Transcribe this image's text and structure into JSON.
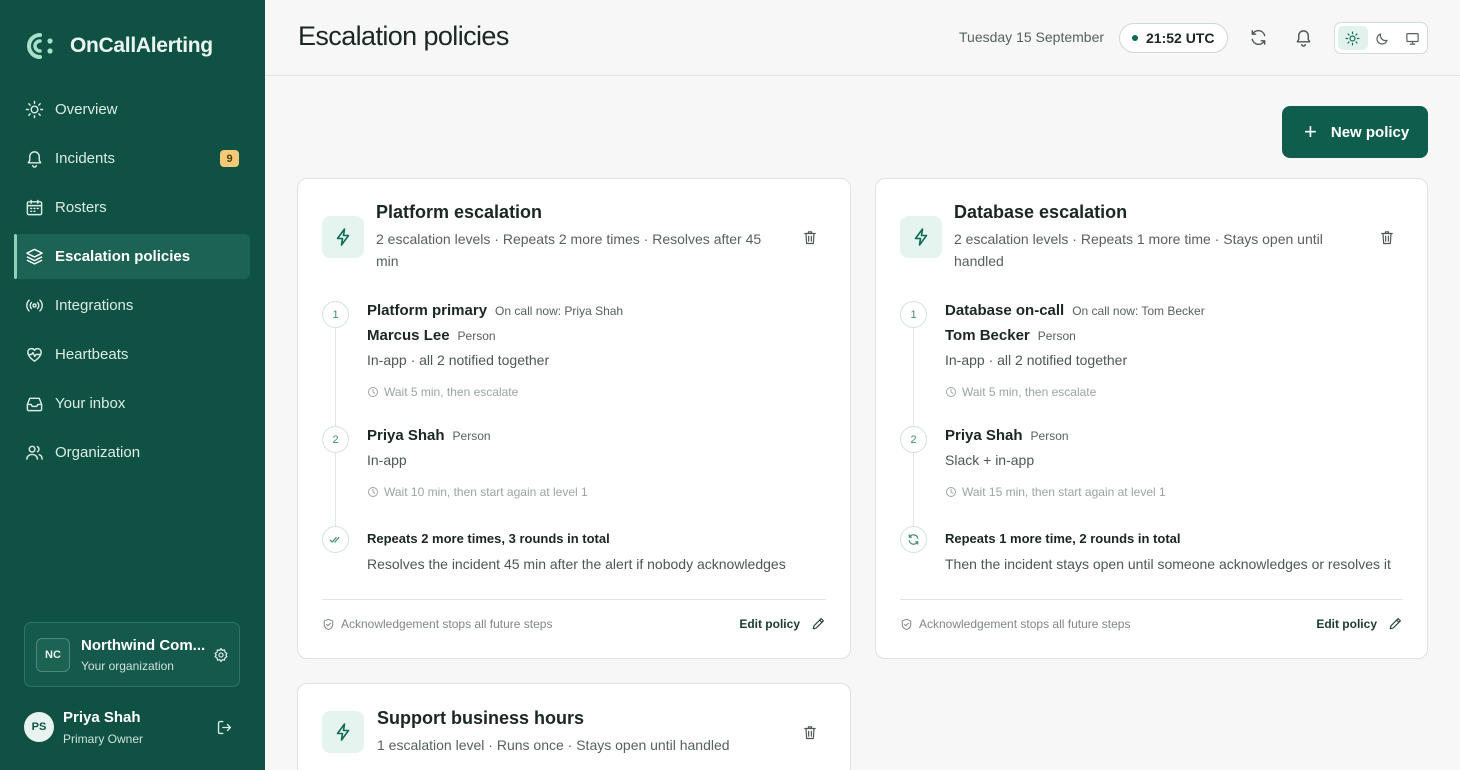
{
  "app": {
    "name": "OnCallAlerting"
  },
  "sidebar": {
    "items": [
      {
        "label": "Overview",
        "icon": "sun-icon"
      },
      {
        "label": "Incidents",
        "icon": "bell-icon",
        "badge": "9"
      },
      {
        "label": "Rosters",
        "icon": "calendar-icon"
      },
      {
        "label": "Escalation policies",
        "icon": "layers-icon",
        "active": true
      },
      {
        "label": "Integrations",
        "icon": "broadcast-icon"
      },
      {
        "label": "Heartbeats",
        "icon": "heart-pulse-icon"
      },
      {
        "label": "Your inbox",
        "icon": "inbox-icon"
      },
      {
        "label": "Organization",
        "icon": "users-icon"
      }
    ],
    "org": {
      "initials": "NC",
      "name": "Northwind Com...",
      "subtitle": "Your organization"
    },
    "user": {
      "initials": "PS",
      "name": "Priya Shah",
      "role": "Primary Owner"
    }
  },
  "header": {
    "title": "Escalation policies",
    "date": "Tuesday 15 September",
    "time": "21:52 UTC",
    "theme_selected": "light"
  },
  "actions": {
    "new_policy": "New policy"
  },
  "policies": [
    {
      "title": "Platform escalation",
      "summary": "2 escalation levels · Repeats 2 more times · Resolves after 45 min",
      "levels": [
        {
          "num": "1",
          "title": "Platform primary",
          "oncall": "On call now: Priya Shah",
          "person": "Marcus Lee",
          "person_type": "Person",
          "channel": "In-app · all 2 notified together",
          "wait": "Wait 5 min, then escalate"
        },
        {
          "num": "2",
          "person": "Priya Shah",
          "person_type": "Person",
          "channel": "In-app",
          "wait": "Wait 10 min, then start again at level 1"
        }
      ],
      "repeat_title": "Repeats 2 more times, 3 rounds in total",
      "repeat_desc": "Resolves the incident 45 min after the alert if nobody acknowledges",
      "ack_note": "Acknowledgement stops all future steps",
      "edit_label": "Edit policy"
    },
    {
      "title": "Database escalation",
      "summary": "2 escalation levels · Repeats 1 more time · Stays open until handled",
      "levels": [
        {
          "num": "1",
          "title": "Database on-call",
          "oncall": "On call now: Tom Becker",
          "person": "Tom Becker",
          "person_type": "Person",
          "channel": "In-app · all 2 notified together",
          "wait": "Wait 5 min, then escalate"
        },
        {
          "num": "2",
          "person": "Priya Shah",
          "person_type": "Person",
          "channel": "Slack + in-app",
          "wait": "Wait 15 min, then start again at level 1"
        }
      ],
      "repeat_title": "Repeats 1 more time, 2 rounds in total",
      "repeat_desc": "Then the incident stays open until someone acknowledges or resolves it",
      "ack_note": "Acknowledgement stops all future steps",
      "edit_label": "Edit policy"
    },
    {
      "title": "Support business hours",
      "summary": "1 escalation level · Runs once · Stays open until handled"
    }
  ]
}
